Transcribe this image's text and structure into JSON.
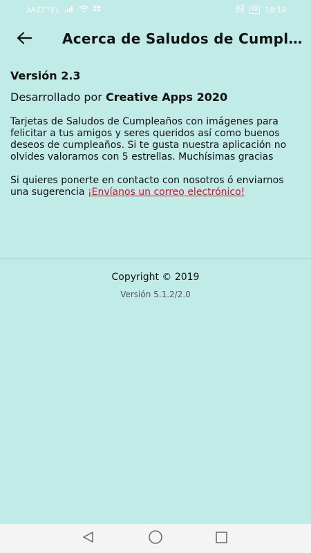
{
  "status_bar": {
    "carrier": "JAZZTEL",
    "battery": "58",
    "time": "18:19"
  },
  "app_bar": {
    "title": "Acerca de Saludos de Cumpleaños",
    "back_icon": "arrow-back-icon"
  },
  "about": {
    "version": "Versión 2.3",
    "developed_by_prefix": "Desarrollado por ",
    "developer": "Creative Apps 2020",
    "description": "Tarjetas de Saludos de Cumpleaños con imágenes para felicitar a tus amigos y seres queridos así como buenos deseos de cumpleaños. Si te gusta nuestra aplicación no olvides valorarnos con 5 estrellas. Muchísimas gracias",
    "contact_text": "Si quieres ponerte en contacto con nosotros ó enviarnos una sugerencia ",
    "contact_link": "¡Envíanos un correo electrónico!"
  },
  "footer": {
    "copyright": "Copyright © 2019",
    "app_version": "Versión 5.1.2/2.0"
  },
  "nav_bar": {
    "back_icon": "triangle-back-icon",
    "home_icon": "circle-home-icon",
    "recents_icon": "square-recents-icon"
  },
  "colors": {
    "background": "#c0ebe7",
    "link": "#d0102d"
  }
}
